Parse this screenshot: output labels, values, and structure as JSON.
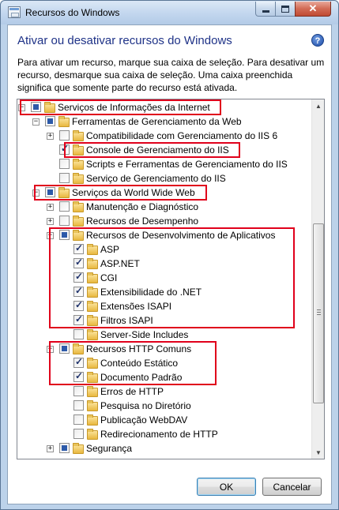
{
  "window": {
    "title": "Recursos do Windows",
    "close_symbol": "✕"
  },
  "heading": "Ativar ou desativar recursos do Windows",
  "help_symbol": "?",
  "intro": "Para ativar um recurso, marque sua caixa de seleção. Para desativar um recurso, desmarque sua caixa de seleção. Uma caixa preenchida significa que somente parte do recurso está ativada.",
  "tree": [
    {
      "label": "Serviços de Informações da Internet",
      "state": "partial",
      "expander": "−"
    },
    {
      "label": "Ferramentas de Gerenciamento da Web",
      "state": "partial",
      "expander": "−"
    },
    {
      "label": "Compatibilidade com Gerenciamento do IIS 6",
      "state": "unchecked",
      "expander": "+"
    },
    {
      "label": "Console de Gerenciamento do IIS",
      "state": "checked",
      "expander": ""
    },
    {
      "label": "Scripts e Ferramentas de Gerenciamento do IIS",
      "state": "unchecked",
      "expander": ""
    },
    {
      "label": "Serviço de Gerenciamento do IIS",
      "state": "unchecked",
      "expander": ""
    },
    {
      "label": "Serviços da World Wide Web",
      "state": "partial",
      "expander": "−"
    },
    {
      "label": "Manutenção e Diagnóstico",
      "state": "unchecked",
      "expander": "+"
    },
    {
      "label": "Recursos de Desempenho",
      "state": "unchecked",
      "expander": "+"
    },
    {
      "label": "Recursos de Desenvolvimento de Aplicativos",
      "state": "partial",
      "expander": "−"
    },
    {
      "label": "ASP",
      "state": "checked",
      "expander": ""
    },
    {
      "label": "ASP.NET",
      "state": "checked",
      "expander": ""
    },
    {
      "label": "CGI",
      "state": "checked",
      "expander": ""
    },
    {
      "label": "Extensibilidade do .NET",
      "state": "checked",
      "expander": ""
    },
    {
      "label": "Extensões ISAPI",
      "state": "checked",
      "expander": ""
    },
    {
      "label": "Filtros ISAPI",
      "state": "checked",
      "expander": ""
    },
    {
      "label": "Server-Side Includes",
      "state": "unchecked",
      "expander": ""
    },
    {
      "label": "Recursos HTTP Comuns",
      "state": "partial",
      "expander": "−"
    },
    {
      "label": "Conteúdo Estático",
      "state": "checked",
      "expander": ""
    },
    {
      "label": "Documento Padrão",
      "state": "checked",
      "expander": ""
    },
    {
      "label": "Erros de HTTP",
      "state": "unchecked",
      "expander": ""
    },
    {
      "label": "Pesquisa no Diretório",
      "state": "unchecked",
      "expander": ""
    },
    {
      "label": "Publicação WebDAV",
      "state": "unchecked",
      "expander": ""
    },
    {
      "label": "Redirecionamento de HTTP",
      "state": "unchecked",
      "expander": ""
    },
    {
      "label": "Segurança",
      "state": "partial",
      "expander": "+"
    }
  ],
  "buttons": {
    "ok": "OK",
    "cancel": "Cancelar"
  },
  "colors": {
    "highlight": "#e0001b",
    "heading": "#1e3287"
  }
}
